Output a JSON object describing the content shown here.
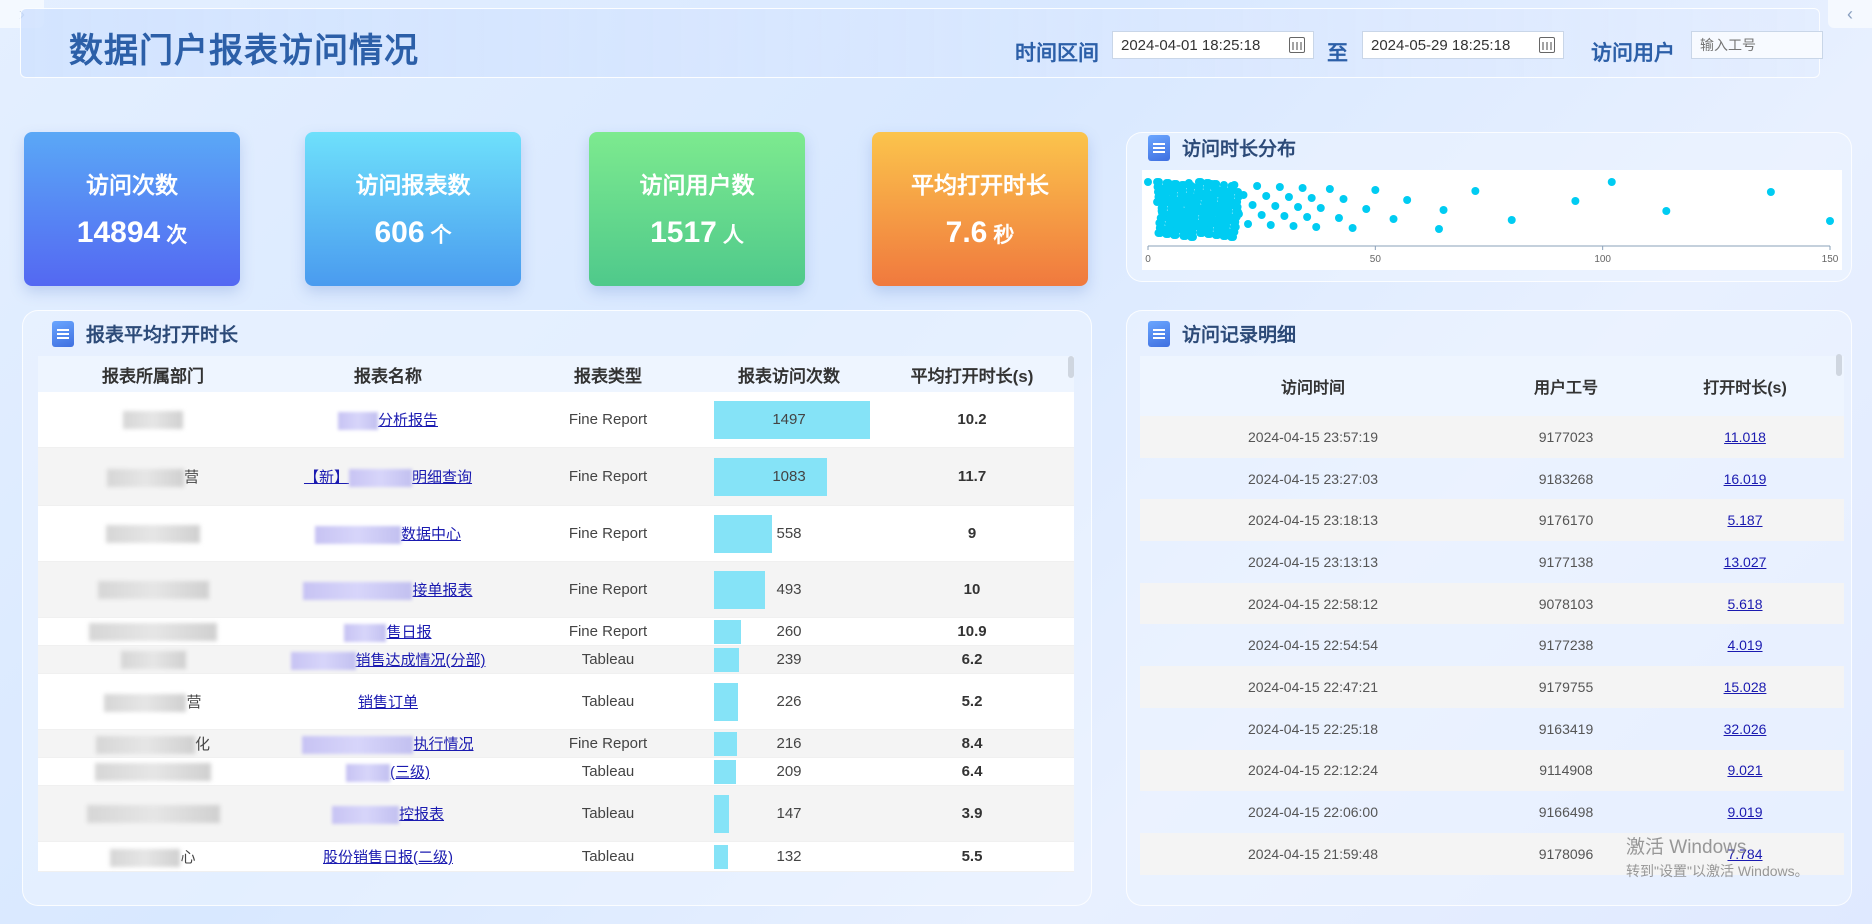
{
  "page": {
    "title": "数据门户报表访问情况"
  },
  "filters": {
    "time_label": "时间区间",
    "start": "2024-04-01 18:25:18",
    "sep": "至",
    "end": "2024-05-29 18:25:18",
    "user_label": "访问用户",
    "user_placeholder": "输入工号"
  },
  "kpis": [
    {
      "title": "访问次数",
      "value": "14894",
      "unit": "次"
    },
    {
      "title": "访问报表数",
      "value": "606",
      "unit": "个"
    },
    {
      "title": "访问用户数",
      "value": "1517",
      "unit": "人"
    },
    {
      "title": "平均打开时长",
      "value": "7.6",
      "unit": "秒"
    }
  ],
  "duration_panel": {
    "title": "访问时长分布",
    "ticks": [
      "0",
      "50",
      "100",
      "150"
    ]
  },
  "chart_data": {
    "type": "scatter",
    "xlim": [
      0,
      150
    ],
    "points": [
      0,
      3,
      5,
      7,
      8,
      9,
      10,
      11,
      12,
      13,
      14,
      15,
      16,
      17,
      18,
      19,
      20,
      21,
      22,
      23,
      24,
      25,
      26,
      27,
      28,
      29,
      30,
      31,
      32,
      33,
      34,
      35,
      36,
      37,
      38,
      40,
      42,
      43,
      45,
      48,
      50,
      54,
      57,
      64,
      65,
      72,
      80,
      94,
      102,
      114,
      137,
      150
    ]
  },
  "report_panel": {
    "title": "报表平均打开时长",
    "headers": [
      "报表所属部门",
      "报表名称",
      "报表类型",
      "报表访问次数",
      "平均打开时长(s)"
    ],
    "rows": [
      {
        "dept": "",
        "name": "分析报告",
        "type": "Fine Report",
        "visits": 1497,
        "avg": "10.2"
      },
      {
        "dept": "营",
        "name": "明细查询",
        "prefix": "【新】",
        "type": "Fine Report",
        "visits": 1083,
        "avg": "11.7"
      },
      {
        "dept": "",
        "name": "数据中心",
        "type": "Fine Report",
        "visits": 558,
        "avg": "9"
      },
      {
        "dept": "",
        "name": "接单报表",
        "type": "Fine Report",
        "visits": 493,
        "avg": "10"
      },
      {
        "dept": "",
        "name": "售日报",
        "type": "Fine Report",
        "visits": 260,
        "avg": "10.9"
      },
      {
        "dept": "",
        "name": "销售达成情况(分部)",
        "type": "Tableau",
        "visits": 239,
        "avg": "6.2"
      },
      {
        "dept": "营",
        "name": "销售订单",
        "type": "Tableau",
        "visits": 226,
        "avg": "5.2"
      },
      {
        "dept": "化",
        "name": "执行情况",
        "type": "Fine Report",
        "visits": 216,
        "avg": "8.4"
      },
      {
        "dept": "",
        "name": "(三级)",
        "type": "Tableau",
        "visits": 209,
        "avg": "6.4"
      },
      {
        "dept": "",
        "name": "控报表",
        "type": "Tableau",
        "visits": 147,
        "avg": "3.9"
      },
      {
        "dept": "心",
        "name": "股份销售日报(二级)",
        "type": "Tableau",
        "visits": 132,
        "avg": "5.5"
      }
    ]
  },
  "record_panel": {
    "title": "访问记录明细",
    "headers": [
      "访问时间",
      "用户工号",
      "打开时长(s)"
    ],
    "rows": [
      [
        "2024-04-15 23:57:19",
        "9177023",
        "11.018"
      ],
      [
        "2024-04-15 23:27:03",
        "9183268",
        "16.019"
      ],
      [
        "2024-04-15 23:18:13",
        "9176170",
        "5.187"
      ],
      [
        "2024-04-15 23:13:13",
        "9177138",
        "13.027"
      ],
      [
        "2024-04-15 22:58:12",
        "9078103",
        "5.618"
      ],
      [
        "2024-04-15 22:54:54",
        "9177238",
        "4.019"
      ],
      [
        "2024-04-15 22:47:21",
        "9179755",
        "15.028"
      ],
      [
        "2024-04-15 22:25:18",
        "9163419",
        "32.026"
      ],
      [
        "2024-04-15 22:12:24",
        "9114908",
        "9.021"
      ],
      [
        "2024-04-15 22:06:00",
        "9166498",
        "9.019"
      ],
      [
        "2024-04-15 21:59:48",
        "9178096",
        "7.784"
      ]
    ]
  },
  "watermark": {
    "line1": "激活 Windows",
    "line2": "转到\"设置\"以激活 Windows。"
  }
}
